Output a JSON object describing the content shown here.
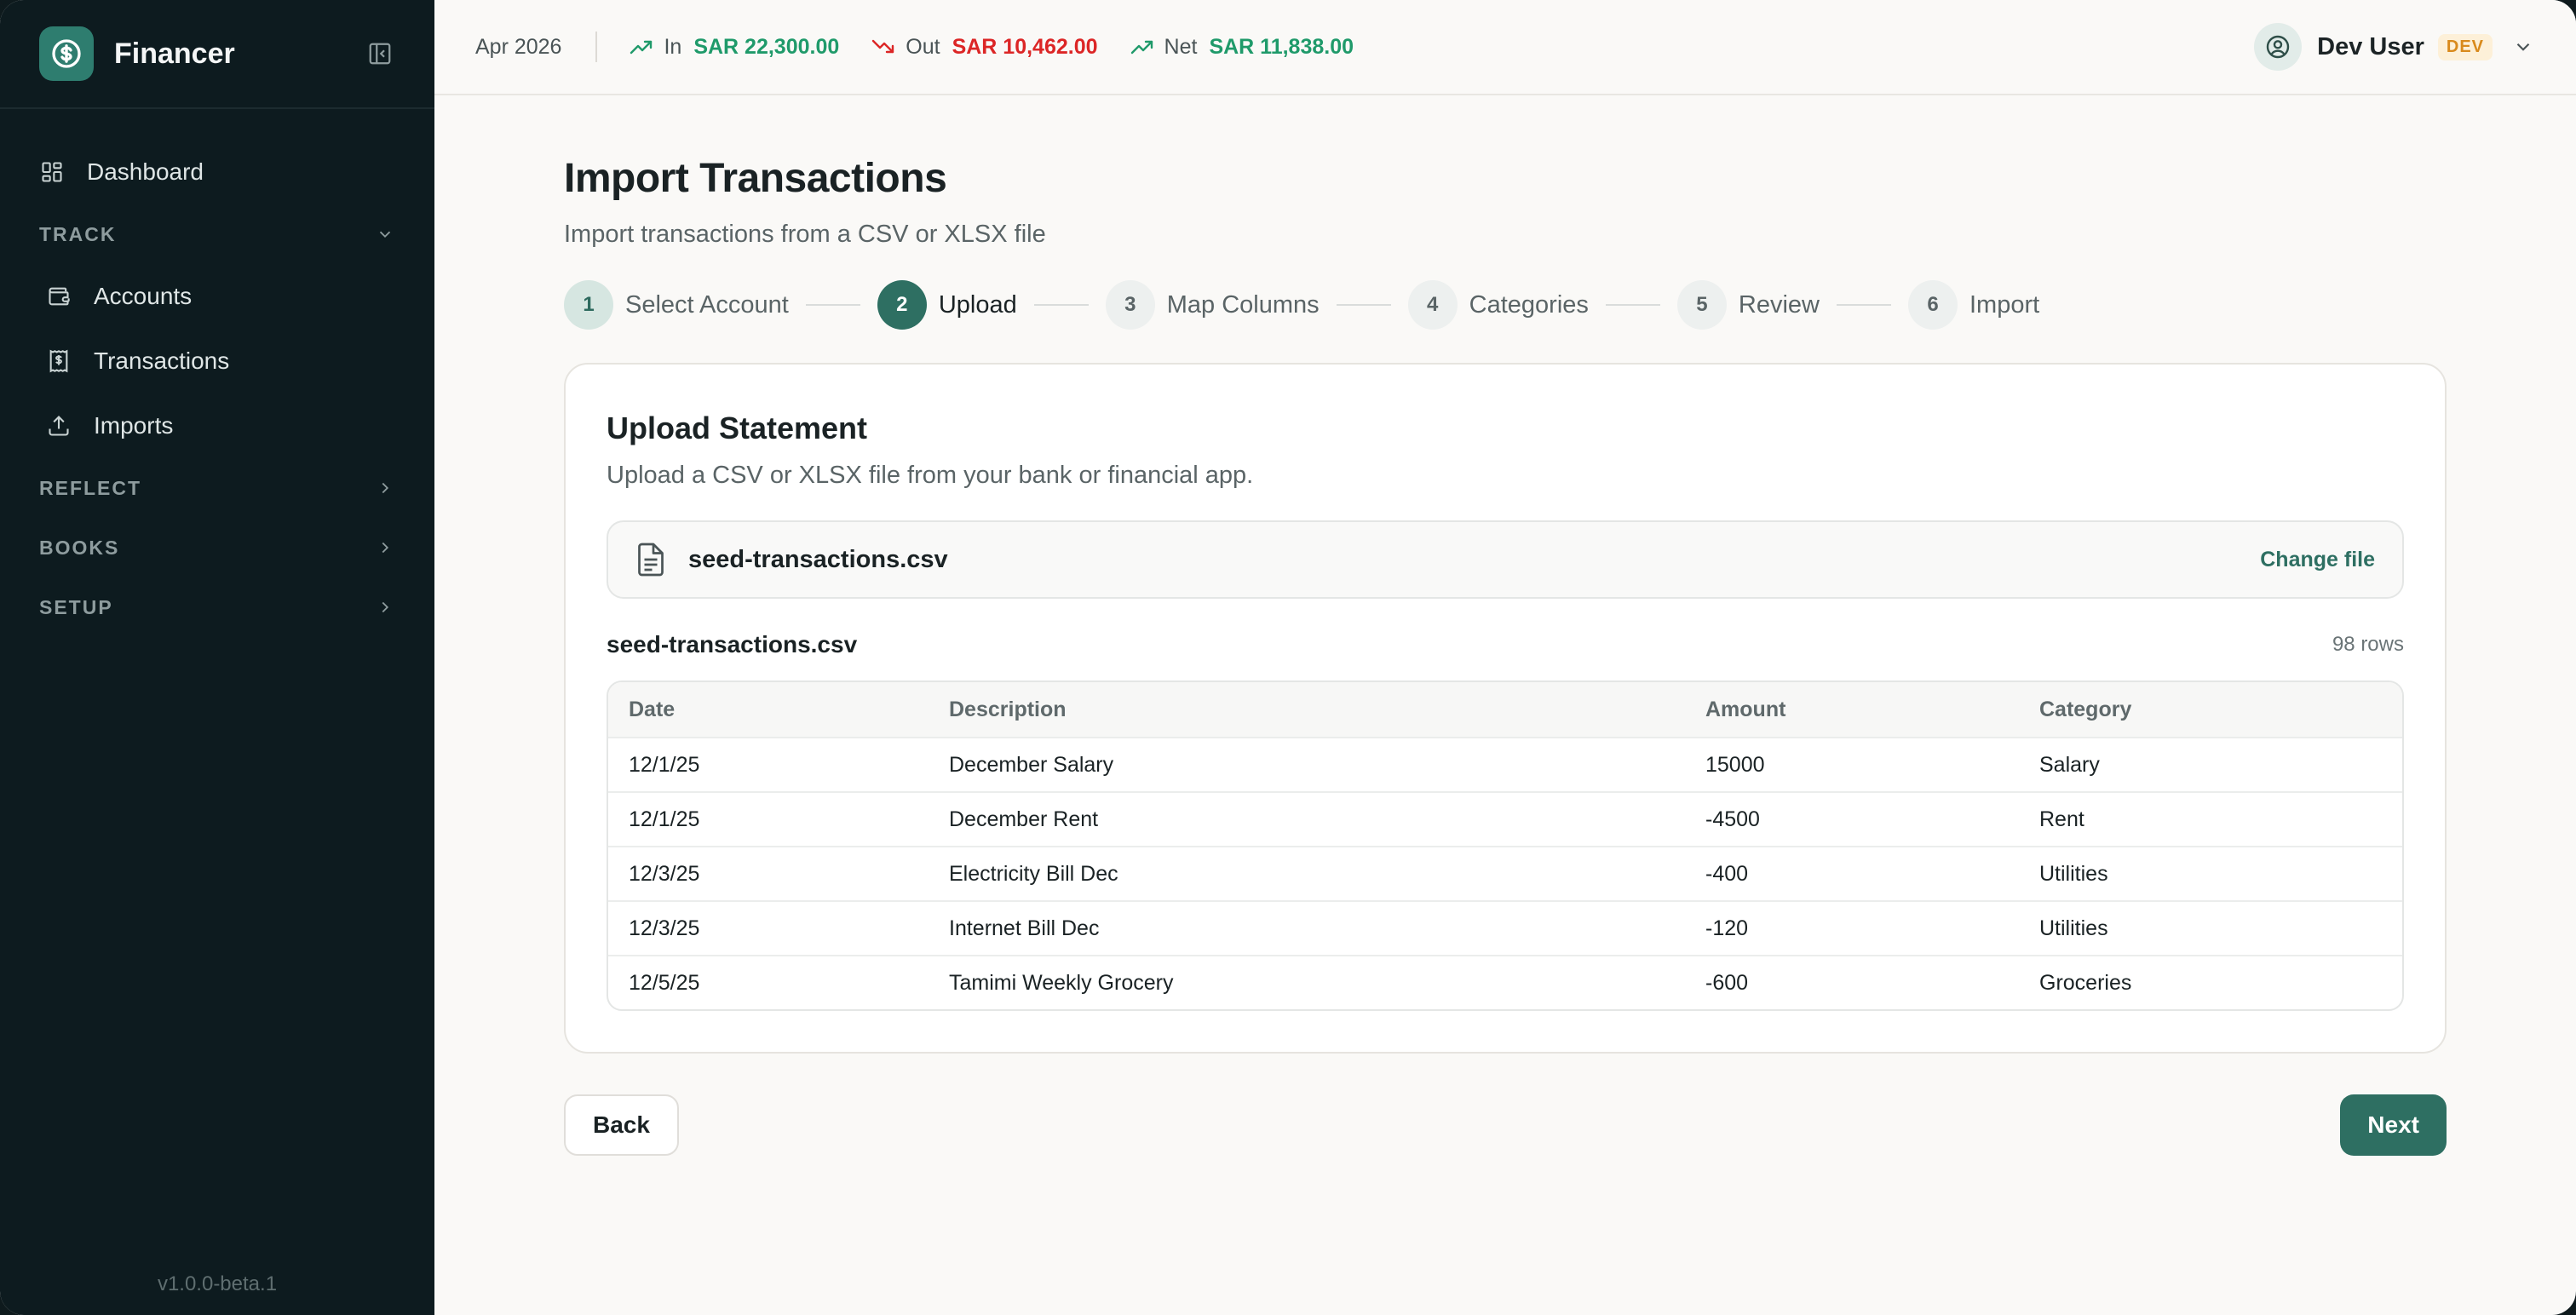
{
  "app": {
    "name": "Financer",
    "version": "v1.0.0-beta.1"
  },
  "sidebar": {
    "dashboard": "Dashboard",
    "track": {
      "label": "TRACK",
      "items": [
        "Accounts",
        "Transactions",
        "Imports"
      ]
    },
    "reflect": "REFLECT",
    "books": "BOOKS",
    "setup": "SETUP"
  },
  "topbar": {
    "period": "Apr 2026",
    "in": {
      "label": "In",
      "value": "SAR 22,300.00"
    },
    "out": {
      "label": "Out",
      "value": "SAR 10,462.00"
    },
    "net": {
      "label": "Net",
      "value": "SAR 11,838.00"
    },
    "user": {
      "name": "Dev User",
      "badge": "DEV"
    }
  },
  "page": {
    "title": "Import Transactions",
    "subtitle": "Import transactions from a CSV or XLSX file"
  },
  "steps": [
    {
      "num": "1",
      "label": "Select Account",
      "state": "done"
    },
    {
      "num": "2",
      "label": "Upload",
      "state": "active"
    },
    {
      "num": "3",
      "label": "Map Columns",
      "state": "pending"
    },
    {
      "num": "4",
      "label": "Categories",
      "state": "pending"
    },
    {
      "num": "5",
      "label": "Review",
      "state": "pending"
    },
    {
      "num": "6",
      "label": "Import",
      "state": "pending"
    }
  ],
  "upload": {
    "title": "Upload Statement",
    "subtitle": "Upload a CSV or XLSX file from your bank or financial app.",
    "file_name": "seed-transactions.csv",
    "change_label": "Change file"
  },
  "preview": {
    "file_name": "seed-transactions.csv",
    "rows_label": "98 rows",
    "columns": [
      "Date",
      "Description",
      "Amount",
      "Category"
    ],
    "rows": [
      [
        "12/1/25",
        "December Salary",
        "15000",
        "Salary"
      ],
      [
        "12/1/25",
        "December Rent",
        "-4500",
        "Rent"
      ],
      [
        "12/3/25",
        "Electricity Bill Dec",
        "-400",
        "Utilities"
      ],
      [
        "12/3/25",
        "Internet Bill Dec",
        "-120",
        "Utilities"
      ],
      [
        "12/5/25",
        "Tamimi Weekly Grocery",
        "-600",
        "Groceries"
      ]
    ]
  },
  "actions": {
    "back": "Back",
    "next": "Next"
  },
  "colors": {
    "brand": "#2e7d6f",
    "primary": "#2e6f62",
    "income": "#1f9a6a",
    "expense": "#dc2626",
    "sidebar_bg": "#0d1b1f"
  }
}
